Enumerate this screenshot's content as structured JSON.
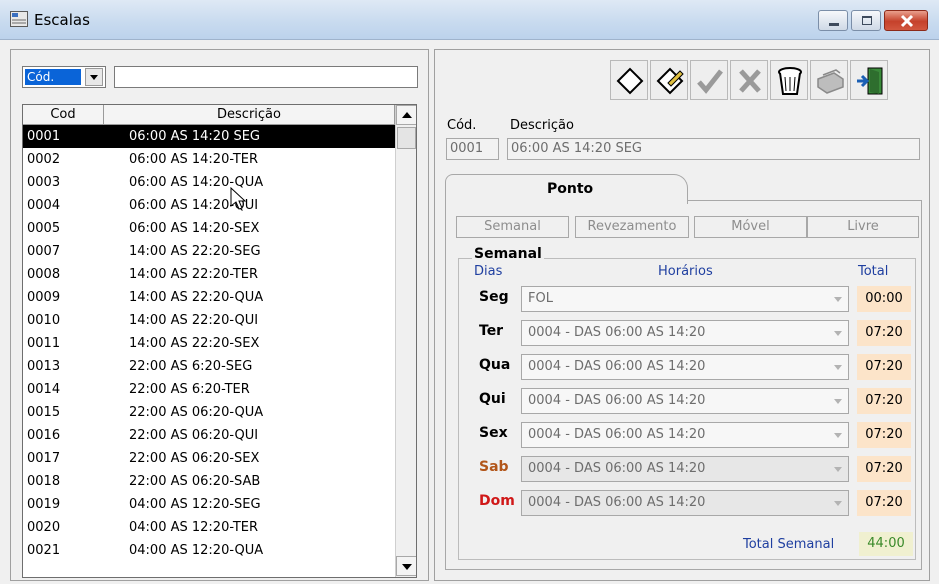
{
  "window": {
    "title": "Escalas"
  },
  "search": {
    "field_value": "Cód.",
    "input_value": ""
  },
  "grid": {
    "columns": [
      "Cod",
      "Descrição"
    ],
    "rows": [
      [
        "0001",
        "06:00 AS 14:20 SEG"
      ],
      [
        "0002",
        "06:00 AS 14:20-TER"
      ],
      [
        "0003",
        "06:00 AS 14:20-QUA"
      ],
      [
        "0004",
        "06:00 AS 14:20-QUI"
      ],
      [
        "0005",
        "06:00 AS 14:20-SEX"
      ],
      [
        "0007",
        "14:00 AS 22:20-SEG"
      ],
      [
        "0008",
        "14:00 AS 22:20-TER"
      ],
      [
        "0009",
        "14:00 AS 22:20-QUA"
      ],
      [
        "0010",
        "14:00 AS 22:20-QUI"
      ],
      [
        "0011",
        "14:00 AS 22:20-SEX"
      ],
      [
        "0013",
        "22:00 AS 6:20-SEG"
      ],
      [
        "0014",
        "22:00 AS 6:20-TER"
      ],
      [
        "0015",
        "22:00 AS 06:20-QUA"
      ],
      [
        "0016",
        "22:00 AS 06:20-QUI"
      ],
      [
        "0017",
        "22:00 AS 06:20-SEX"
      ],
      [
        "0018",
        "22:00 AS 06:20-SAB"
      ],
      [
        "0019",
        "04:00 AS 12:20-SEG"
      ],
      [
        "0020",
        "04:00 AS 12:20-TER"
      ],
      [
        "0021",
        "04:00 AS 12:20-QUA"
      ]
    ],
    "selected_code": "0001"
  },
  "toolbar": {
    "icons": [
      "new-icon",
      "edit-icon",
      "confirm-icon",
      "cancel-icon",
      "delete-icon",
      "print-icon",
      "exit-icon"
    ]
  },
  "record": {
    "code_label": "Cód.",
    "desc_label": "Descrição",
    "code_value": "0001",
    "desc_value": "06:00 AS 14:20 SEG"
  },
  "tabs": {
    "active": "Ponto"
  },
  "subtabs": [
    "Semanal",
    "Revezamento",
    "Móvel",
    "Livre"
  ],
  "semanal": {
    "legend": "Semanal",
    "col_days": "Dias",
    "col_hours": "Horários",
    "col_total": "Total",
    "days": [
      {
        "label": "Seg",
        "schedule": "FOL",
        "total": "00:00",
        "color": "#000000"
      },
      {
        "label": "Ter",
        "schedule": "0004 - DAS 06:00 AS 14:20",
        "total": "07:20",
        "color": "#000000"
      },
      {
        "label": "Qua",
        "schedule": "0004 - DAS 06:00 AS 14:20",
        "total": "07:20",
        "color": "#000000"
      },
      {
        "label": "Qui",
        "schedule": "0004 - DAS 06:00 AS 14:20",
        "total": "07:20",
        "color": "#000000"
      },
      {
        "label": "Sex",
        "schedule": "0004 - DAS 06:00 AS 14:20",
        "total": "07:20",
        "color": "#000000"
      },
      {
        "label": "Sab",
        "schedule": "0004 - DAS 06:00 AS 14:20",
        "total": "07:20",
        "color": "#b2561a"
      },
      {
        "label": "Dom",
        "schedule": "0004 - DAS 06:00 AS 14:20",
        "total": "07:20",
        "color": "#d01818"
      }
    ],
    "weekly_label": "Total Semanal",
    "weekly_total": "44:00"
  }
}
